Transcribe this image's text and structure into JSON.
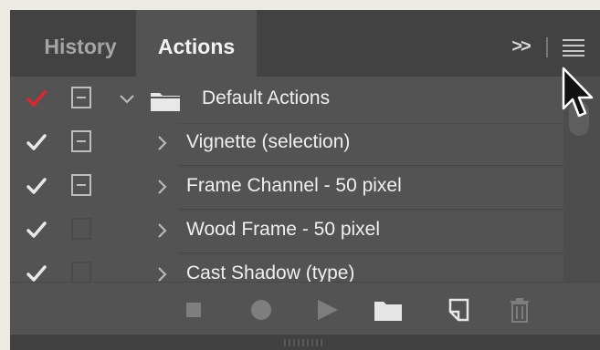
{
  "tabs": [
    {
      "label": "History",
      "active": false
    },
    {
      "label": "Actions",
      "active": true
    }
  ],
  "header": {
    "expand_glyph": ">>",
    "menu_icon": "hamburger-menu-icon"
  },
  "actions": [
    {
      "label": "Default Actions",
      "type": "set",
      "checked": true,
      "check_color": "#e0262c",
      "dialog": true,
      "expanded": true
    },
    {
      "label": "Vignette (selection)",
      "type": "action",
      "checked": true,
      "check_color": "#e8e8e8",
      "dialog": true,
      "expanded": false
    },
    {
      "label": "Frame Channel - 50 pixel",
      "type": "action",
      "checked": true,
      "check_color": "#e8e8e8",
      "dialog": true,
      "expanded": false
    },
    {
      "label": "Wood Frame - 50 pixel",
      "type": "action",
      "checked": true,
      "check_color": "#e8e8e8",
      "dialog": false,
      "expanded": false
    },
    {
      "label": "Cast Shadow (type)",
      "type": "action",
      "checked": true,
      "check_color": "#e8e8e8",
      "dialog": false,
      "expanded": false
    }
  ],
  "toolbar": [
    "stop-icon",
    "record-icon",
    "play-icon",
    "new-set-folder-icon",
    "new-action-icon",
    "trash-icon"
  ],
  "colors": {
    "panel": "#535353",
    "header": "#424242",
    "accent_check": "#e0262c",
    "text": "#efefef"
  }
}
